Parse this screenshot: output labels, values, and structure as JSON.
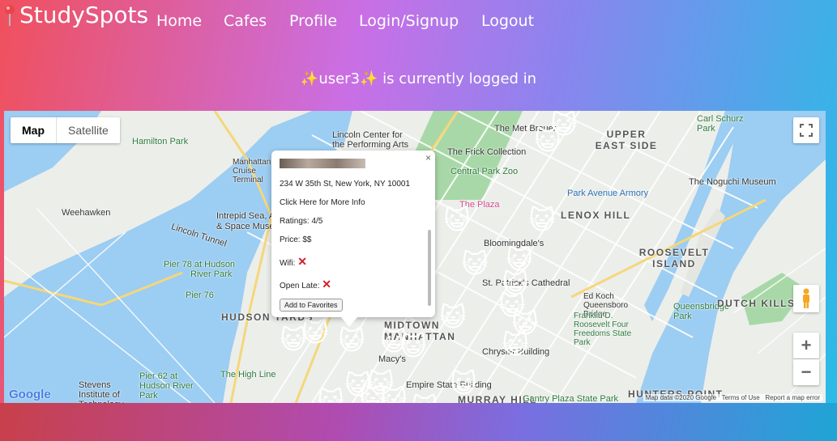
{
  "nav": {
    "brand": "StudySpots",
    "links": [
      "Home",
      "Cafes",
      "Profile",
      "Login/Signup",
      "Logout"
    ]
  },
  "status": {
    "logged_in_message": "✨user3✨ is currently logged in"
  },
  "map": {
    "type_buttons": [
      "Map",
      "Satellite"
    ],
    "active_type": "Map",
    "labels": [
      "Hamilton Park",
      "Weehawken",
      "Lincoln Tunnel",
      "Intrepid Sea, Air",
      "& Space Museum",
      "Pier 78 at Hudson",
      "River Park",
      "Pier 76",
      "HUDSON YARDS",
      "Manhattan Cruise Terminal",
      "Lincoln Center for",
      "the Performing Arts",
      "The Met Breuer",
      "The Frick Collection",
      "Central Park Zoo",
      "The Plaza",
      "Bloomingdale's",
      "St. Patrick's Cathedral",
      "UPPER EAST SIDE",
      "LENOX HILL",
      "Park Avenue Armory",
      "The Noguchi Museum",
      "Carl Schurz Park",
      "ROOSEVELT ISLAND",
      "Ed Koch Queensboro Bridge",
      "Franklin D. Roosevelt Four Freedoms State Park",
      "Queensbridge Park",
      "DUTCH KILLS",
      "MIDTOWN MANHATTAN",
      "Macy's",
      "Empire State Building",
      "MURRAY HILL",
      "The High Line",
      "Pier 62 at Hudson River Park",
      "Stevens Institute of Technology",
      "Gantry Plaza State Park",
      "HUNTERS POINT",
      "Chrysler Building"
    ],
    "attribution": [
      "Map data ©2020 Google",
      "Terms of Use",
      "Report a map error"
    ],
    "logo": "Google",
    "zoom_in": "+",
    "zoom_out": "−"
  },
  "popup": {
    "address": "234 W 35th St, New York, NY 10001",
    "more_info": "Click Here for More Info",
    "ratings": "Ratings: 4/5",
    "price": "Price: $$",
    "wifi_label": "Wifi:",
    "open_late_label": "Open Late:",
    "button": "Add to Favorites",
    "close": "×"
  }
}
